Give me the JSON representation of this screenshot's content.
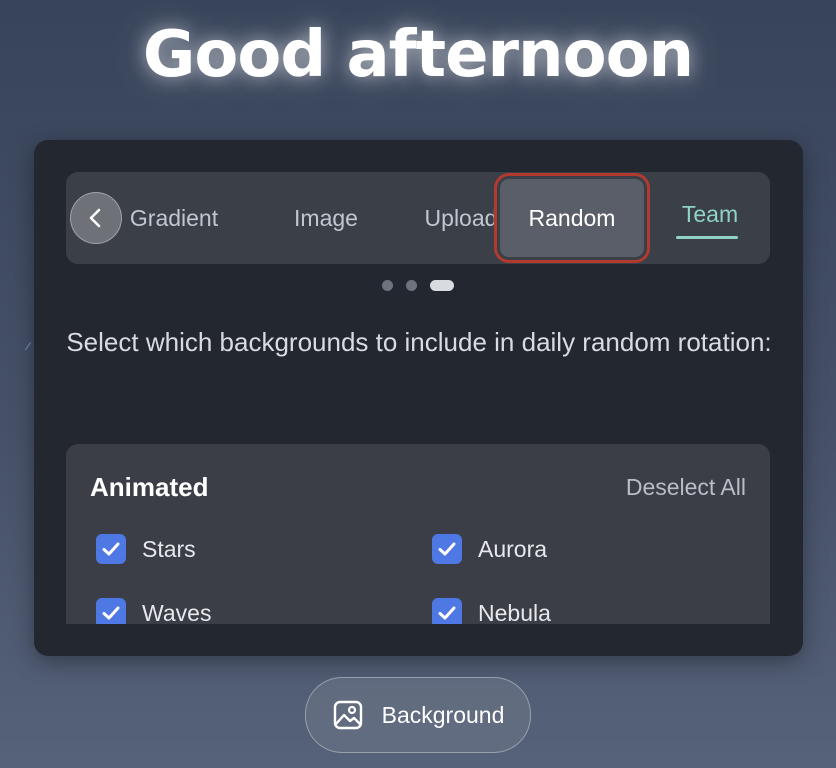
{
  "greeting": "Good afternoon",
  "tabs": {
    "gradient": "Gradient",
    "image": "Image",
    "upload": "Upload",
    "random": "Random",
    "team": "Team"
  },
  "carousel": {
    "page_count": 3,
    "active_page": 3
  },
  "instructions": "Select which backgrounds to include in daily random rotation:",
  "section": {
    "title": "Animated",
    "deselect_label": "Deselect All",
    "options": [
      {
        "label": "Stars",
        "checked": true
      },
      {
        "label": "Aurora",
        "checked": true
      },
      {
        "label": "Waves",
        "checked": true
      },
      {
        "label": "Nebula",
        "checked": true
      }
    ]
  },
  "background_button": {
    "label": "Background",
    "icon": "image-icon"
  },
  "colors": {
    "accent_team": "#8fd3c4",
    "checkbox": "#4e78e4",
    "highlight_ring": "#b23a2f"
  }
}
